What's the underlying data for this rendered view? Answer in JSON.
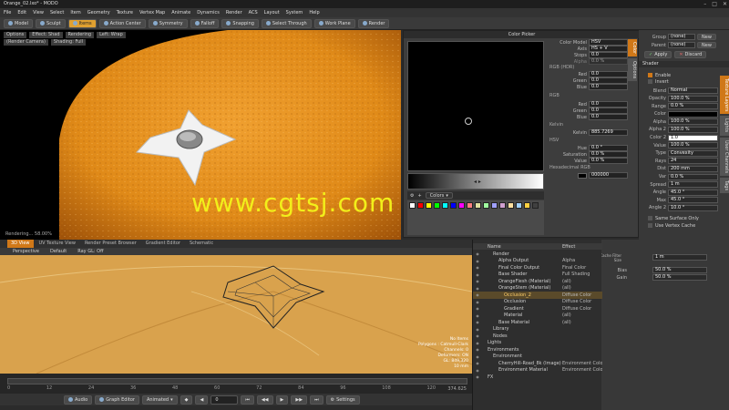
{
  "window": {
    "title": "Orange_02.lxo* - MODO"
  },
  "menu": [
    "File",
    "Edit",
    "View",
    "Select",
    "Item",
    "Geometry",
    "Texture",
    "Vertex Map",
    "Animate",
    "Dynamics",
    "Render",
    "ACS",
    "Layout",
    "System",
    "Help"
  ],
  "toolbar": {
    "buttons": [
      "Model",
      "Sculpt",
      "Items",
      "Action Center",
      "Symmetry",
      "Falloff",
      "Snapping",
      "Select Through",
      "Work Plane",
      "Render"
    ],
    "active": "Items"
  },
  "top_viewport": {
    "tabs": [
      "Options",
      "Effect: Shad",
      "Rendering",
      "Left: Wrap"
    ],
    "tabs2": [
      "(Render Camera)",
      "Shading: Full"
    ],
    "status": "Rendering... 58.00%"
  },
  "watermark": "www.cgtsj.com",
  "bottom_viewport": {
    "tabs": [
      "3D View",
      "UV Texture View",
      "Render Preset Browser",
      "Gradient Editor",
      "Schematic"
    ],
    "active_tab": "3D View",
    "header": [
      "Perspective",
      "Default",
      "Ray GL: Off"
    ],
    "info": [
      "No Items",
      "Polygons : Catmull-Clark",
      "Channels: 0",
      "Deformers: ON",
      "GL: 849,320",
      "10 mm"
    ]
  },
  "timeline": {
    "ticks": [
      "0",
      "12",
      "24",
      "36",
      "48",
      "60",
      "72",
      "84",
      "96",
      "108",
      "120"
    ],
    "end_label": "374.625"
  },
  "playbar": {
    "audio": "Audio",
    "graph_editor": "Graph Editor",
    "animated": "Animated",
    "frame": "0",
    "settings": "Settings"
  },
  "color_picker": {
    "title": "Color Picker",
    "color_model_label": "Color Model",
    "color_model": "HSV",
    "axis_label": "Axis",
    "axis": "HS + V",
    "stops_label": "Stops",
    "stops": "0.0",
    "alpha_label": "Alpha",
    "alpha": "0.0 %",
    "rgb_hdr_label": "RGB (HDR)",
    "red_label": "Red",
    "red": "0.0",
    "green_label": "Green",
    "green": "0.0",
    "blue_label": "Blue",
    "blue": "0.0",
    "rgb_label": "RGB",
    "red2": "0.0",
    "green2": "0.0",
    "blue2": "0.0",
    "kelvin_section": "Kelvin",
    "kelvin_label": "Kelvin",
    "kelvin": "885.7269",
    "hsv_label": "HSV",
    "hue_label": "Hue",
    "hue": "0.0 °",
    "sat_label": "Saturation",
    "sat": "0.0 %",
    "value_label": "Value",
    "value": "0.0 %",
    "hex_label": "Hexadecimal RGB",
    "hex": "000000",
    "swatch_menu": "Colors",
    "side_tabs": [
      "Color",
      "Options"
    ],
    "swatch_colors": [
      "#ffffff",
      "#ff0000",
      "#ffff00",
      "#00ff00",
      "#00ffff",
      "#0000ff",
      "#ff00ff",
      "#ff8080",
      "#e0e0a0",
      "#a0ffa0",
      "#a0a0ff",
      "#d0a0d0",
      "#ffe0a0",
      "#a0d0ff",
      "#ffd040",
      "#404040"
    ]
  },
  "right_panel": {
    "top_labels": [
      "Group",
      "(none)",
      "New"
    ],
    "top_labels2": [
      "Parent",
      "(none)",
      "New"
    ],
    "apply": "Apply",
    "discard": "Discard",
    "tab": "Shader",
    "enable": "Enable",
    "invert": "Invert",
    "fields": [
      {
        "label": "Blend",
        "value": "Normal"
      },
      {
        "label": "Opacity",
        "value": "100.0 %"
      },
      {
        "label": "Range",
        "value": "0.0 %"
      },
      {
        "label": "Color",
        "value": ""
      },
      {
        "label": "Alpha",
        "value": "100.0 %"
      },
      {
        "label": "Alpha 2",
        "value": "100.0 %"
      },
      {
        "label": "Color 2",
        "value": "1.0"
      },
      {
        "label": "Value",
        "value": "100.0 %"
      },
      {
        "label": "Type",
        "value": "Convexity"
      },
      {
        "label": "Rays",
        "value": "24"
      },
      {
        "label": "Dist",
        "value": "200 mm"
      },
      {
        "label": "Var",
        "value": "0.0 %"
      },
      {
        "label": "Spread",
        "value": "1 m"
      },
      {
        "label": "Angle",
        "value": "45.0 °"
      },
      {
        "label": "Max",
        "value": "45.0 °"
      },
      {
        "label": "Angle 2",
        "value": "10.0 °"
      }
    ],
    "same_surface": "Same Surface Only",
    "vertex_cache": "Use Vertex Cache",
    "cache_filter_label": "Cache Filter Size",
    "cache_filter": "1 m",
    "bias_label": "Bias",
    "bias": "50.0 %",
    "gain_label": "Gain",
    "gain": "50.0 %",
    "side_tabs": [
      "Texture Layers",
      "Lights",
      "User Channels",
      "Tags"
    ]
  },
  "shader_tree": {
    "columns": [
      "Name",
      "Effect"
    ],
    "rows": [
      {
        "indent": 1,
        "name": "Render",
        "effect": "",
        "sel": false
      },
      {
        "indent": 2,
        "name": "Alpha Output",
        "effect": "Alpha",
        "sel": false
      },
      {
        "indent": 2,
        "name": "Final Color Output",
        "effect": "Final Color",
        "sel": false
      },
      {
        "indent": 2,
        "name": "Base Shader",
        "effect": "Full Shading",
        "sel": false
      },
      {
        "indent": 2,
        "name": "OrangeFlesh (Material)",
        "effect": "(all)",
        "sel": false
      },
      {
        "indent": 2,
        "name": "OrangeStem (Material)",
        "effect": "(all)",
        "sel": false
      },
      {
        "indent": 3,
        "name": "Occlusion_2",
        "effect": "Diffuse Color",
        "sel": true
      },
      {
        "indent": 3,
        "name": "Occlusion",
        "effect": "Diffuse Color",
        "sel": false
      },
      {
        "indent": 3,
        "name": "Gradient",
        "effect": "Diffuse Color",
        "sel": false
      },
      {
        "indent": 3,
        "name": "Material",
        "effect": "(all)",
        "sel": false
      },
      {
        "indent": 2,
        "name": "Base Material",
        "effect": "(all)",
        "sel": false
      },
      {
        "indent": 1,
        "name": "Library",
        "effect": "",
        "sel": false
      },
      {
        "indent": 1,
        "name": "Nodes",
        "effect": "",
        "sel": false
      },
      {
        "indent": 0,
        "name": "Lights",
        "effect": "",
        "sel": false
      },
      {
        "indent": 0,
        "name": "Environments",
        "effect": "",
        "sel": false
      },
      {
        "indent": 1,
        "name": "Environment",
        "effect": "",
        "sel": false
      },
      {
        "indent": 2,
        "name": "CherryHill-Road_8k (Image)",
        "effect": "Environment Color",
        "sel": false
      },
      {
        "indent": 2,
        "name": "Environment Material",
        "effect": "Environment Color",
        "sel": false
      },
      {
        "indent": 0,
        "name": "FX",
        "effect": "",
        "sel": false
      }
    ]
  }
}
